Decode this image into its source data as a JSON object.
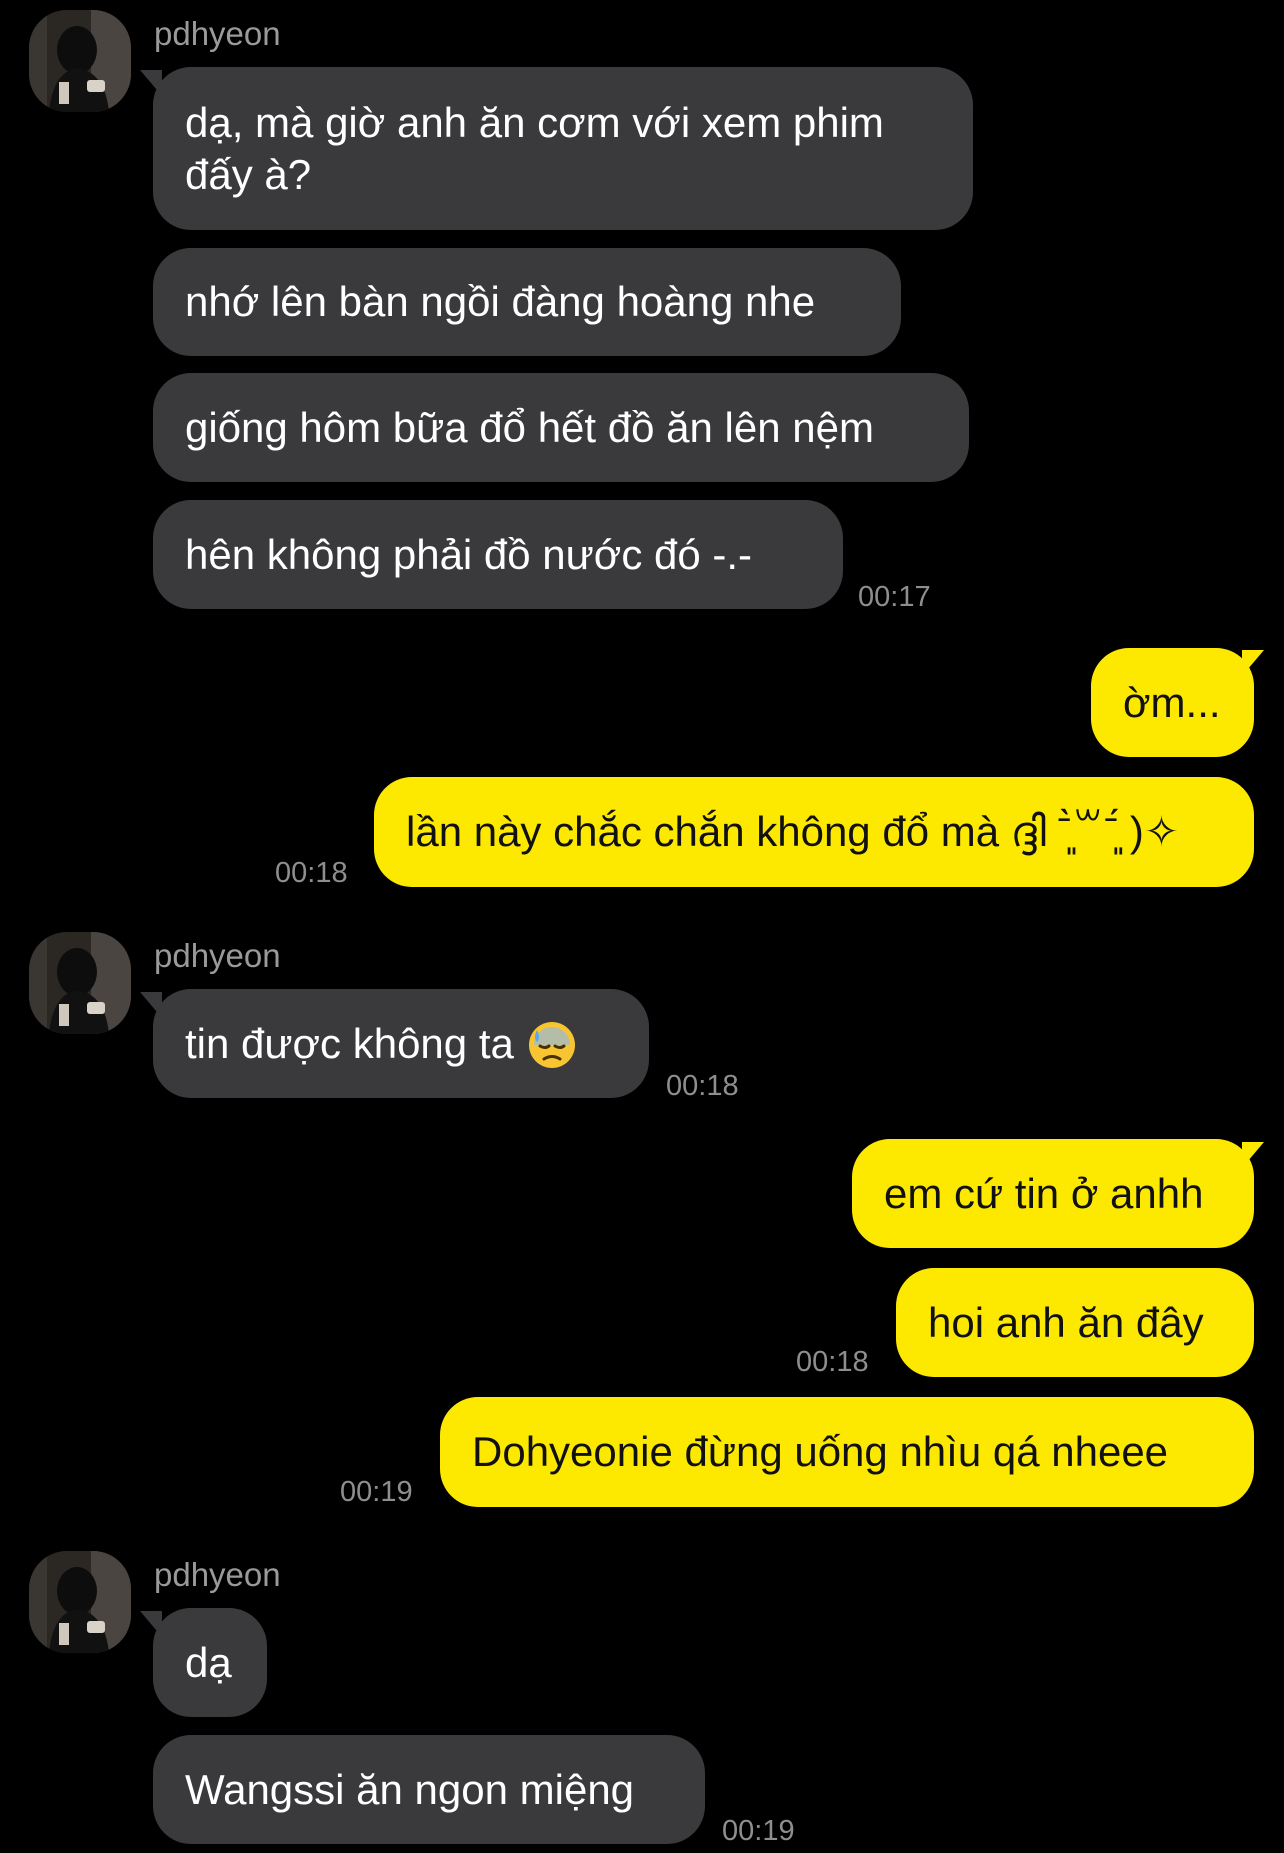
{
  "sender_name": "pdhyeon",
  "messages": {
    "m1": "dạ, mà giờ anh ăn cơm với xem phim",
    "m1b": "đấy à?",
    "m2": "nhớ lên bàn ngồi đàng hoàng nhe",
    "m3": "giống hôm bữa đổ hết đồ ăn lên nệm",
    "m4": "hên không phải đồ nước đó -.-",
    "m5": "ờm...",
    "m6": "lần này chắc chắn không đổ mà ദ്ദി ˉ͈̀꒳ˉ͈́ )✧",
    "m7": "tin được không ta",
    "m8": "em cứ tin ở anhh",
    "m9": "hoi anh ăn đây",
    "m10": "Dohyeonie đừng uống nhìu qá nheee",
    "m11": "dạ",
    "m12": "Wangssi ăn ngon miệng"
  },
  "times": {
    "t1": "00:17",
    "t2": "00:18",
    "t3": "00:18",
    "t4": "00:18",
    "t5": "00:19",
    "t6": "00:19"
  },
  "emoji": {
    "m7_icon": "downcast-face-with-sweat-icon"
  },
  "colors": {
    "background": "#000000",
    "incoming_bubble": "#3a3a3c",
    "outgoing_bubble": "#fde900",
    "timestamp": "#8e8e8e",
    "sender_name": "#9a9a9a"
  }
}
